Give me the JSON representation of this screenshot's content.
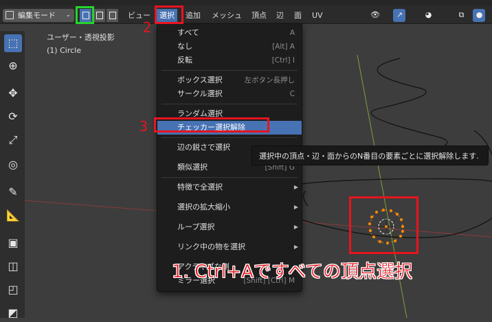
{
  "header": {
    "mode_label": "編集モード",
    "menus": [
      "ビュー",
      "選択",
      "追加",
      "メッシュ",
      "頂点",
      "辺",
      "面",
      "UV"
    ]
  },
  "viewport": {
    "view_label": "ユーザー・透視投影",
    "object_label": "(1) Circle"
  },
  "select_menu": {
    "items": [
      {
        "label": "すべて",
        "shortcut": "A"
      },
      {
        "label": "なし",
        "shortcut": "[Alt] A"
      },
      {
        "label": "反転",
        "shortcut": "[Ctrl] I"
      },
      {
        "label": "ボックス選択",
        "shortcut": "左ボタン長押し"
      },
      {
        "label": "サークル選択",
        "shortcut": "C"
      },
      {
        "label": "ランダム選択",
        "shortcut": ""
      },
      {
        "label": "チェッカー選択解除",
        "shortcut": ""
      },
      {
        "label": "辺の鋭さで選択",
        "shortcut": ""
      },
      {
        "label": "類似選択",
        "shortcut": "[Shift] G"
      },
      {
        "label": "特徴で全選択",
        "shortcut": ""
      },
      {
        "label": "選択の拡大縮小",
        "shortcut": ""
      },
      {
        "label": "ループ選択",
        "shortcut": ""
      },
      {
        "label": "リンク中の物を選択",
        "shortcut": ""
      },
      {
        "label": "アクティブな側",
        "shortcut": ""
      },
      {
        "label": "ミラー選択",
        "shortcut": "[Shift] [Ctrl] M"
      }
    ]
  },
  "tooltip": {
    "text": "選択中の頂点・辺・面からのN番目の要素ごとに選択解除します."
  },
  "annotations": {
    "step2": "2",
    "step3": "3",
    "step1_text": "1. Ctrl+Aですべての頂点選択"
  },
  "colors": {
    "accent": "#4772b3",
    "annotation_red": "#e8141e",
    "annotation_green": "#24d62a",
    "vertex_orange": "#f0860a"
  }
}
